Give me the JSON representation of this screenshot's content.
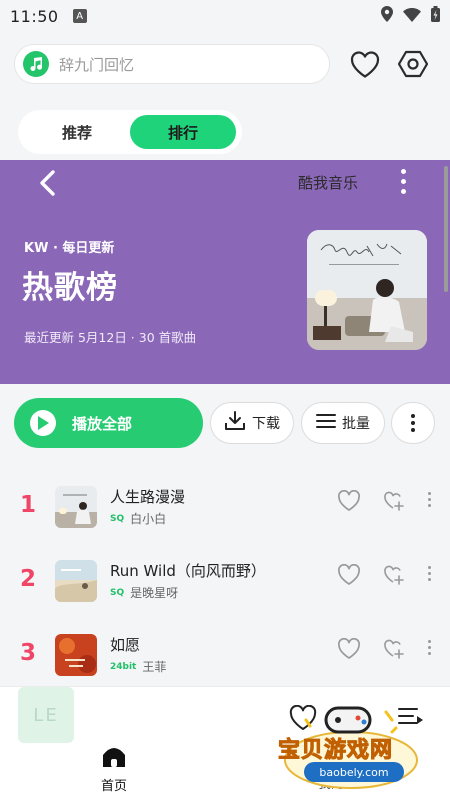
{
  "status_bar": {
    "time": "11:50",
    "notification_letter": "A"
  },
  "search": {
    "placeholder": "辞九门回忆"
  },
  "tabs": [
    {
      "label": "推荐",
      "active": false
    },
    {
      "label": "排行",
      "active": true
    }
  ],
  "chart": {
    "source": "酷我音乐",
    "tag": "KW · 每日更新",
    "title": "热歌榜",
    "info": "最近更新 5月12日 · 30 首歌曲",
    "color": "#8b67b8"
  },
  "actions": {
    "play_all": "播放全部",
    "download": "下载",
    "batch": "批量"
  },
  "songs": [
    {
      "rank": "1",
      "title": "人生路漫漫",
      "quality": "SQ",
      "artist": "白小白"
    },
    {
      "rank": "2",
      "title": "Run Wild（向风而野）",
      "quality": "SQ",
      "artist": "是晚星呀"
    },
    {
      "rank": "3",
      "title": "如愿",
      "quality": "24bit",
      "artist": "王菲"
    }
  ],
  "mini_player": {
    "letters": "LE"
  },
  "bottom_nav": {
    "home": "首页",
    "mine": "我的"
  },
  "watermark": {
    "text": "宝贝游戏网",
    "url": "baobely.com"
  },
  "colors": {
    "accent": "#1fd37a",
    "rank": "#ef4667",
    "hero": "#8b67b8"
  }
}
